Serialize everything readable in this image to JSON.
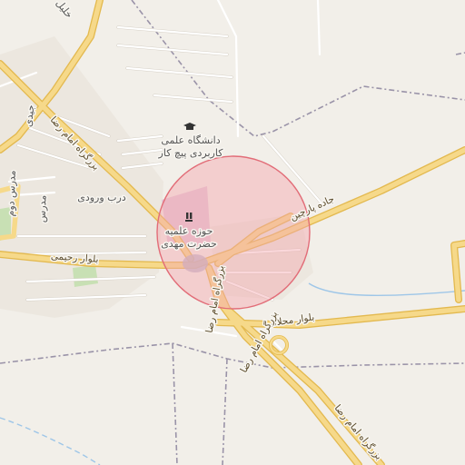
{
  "map": {
    "colors": {
      "background": "#f2efe9",
      "major_road": "#f6d98a",
      "major_road_casing": "#e3b94f",
      "minor_road": "#ffffff",
      "minor_road_casing": "#d6d0c6",
      "boundary": "#9a93a8",
      "water": "#9ec6e8",
      "highlight_fill": "#f4a6ad",
      "highlight_stroke": "#e26d78",
      "campus": "#e4c6d8",
      "park": "#c8e0b4"
    },
    "highlight_circle": {
      "shown": true
    },
    "labels": {
      "university_line1": "دانشگاه علمی",
      "university_line2": "کاربردی پیچ کار",
      "seminary_line1": "حوزه علمیه",
      "seminary_line2": "حضرت مهدی",
      "entrance_gate": "درب ورودی",
      "boulevard_rahimi": "بلوار رحیمی",
      "boulevard_mahallati": "بلوار محلاتی",
      "jadeh_parchin": "جاده پارچین",
      "bozorgrah_imam_reza_1": "بزرگراه امام رضا",
      "bozorgrah_imam_reza_2": "بزرگراه امام رضا",
      "bozorgrah_imam_reza_3": "بزرگراه امام رضا",
      "bozorgrah_imam_reza_4": "بزرگراه امام رضا",
      "madras_1": "مدرس دوم",
      "madras_2": "مدرس",
      "jeidi": "جیدی",
      "top_left": "خلیل"
    },
    "icons": {
      "university": "graduation-cap-icon",
      "seminary": "religious-school-icon"
    }
  }
}
